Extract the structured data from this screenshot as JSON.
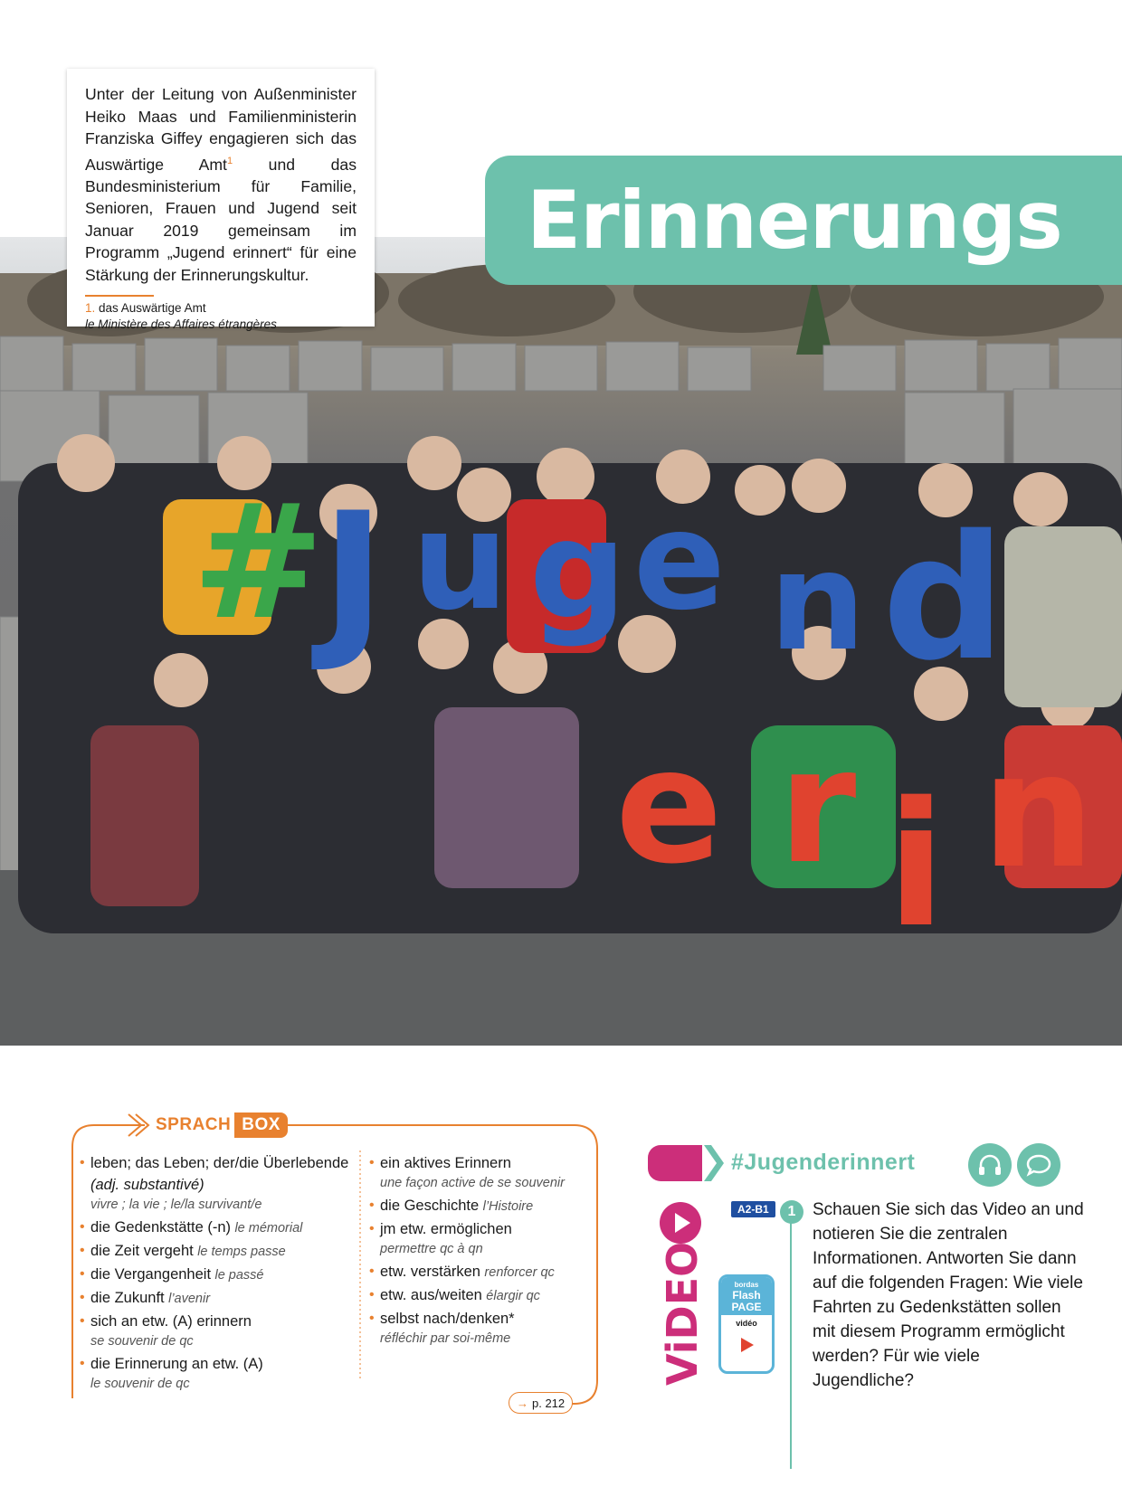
{
  "intro": {
    "text_before_sup": "Unter der Leitung von Außenminister Heiko Maas und Familienministerin Franziska Giffey engagieren sich das Auswärtige Amt",
    "sup": "1",
    "text_after_sup": " und das Bundesministerium für Familie, Senioren, Frauen und Jugend seit Januar 2019 gemeinsam im Programm „Jugend erinnert“ für eine Stärkung der Erinnerungskultur.",
    "footnote_num": "1.",
    "footnote_de": " das Auswärtige Amt",
    "footnote_fr": "le Ministère des Affaires étrangères"
  },
  "title": "Erinnerungs",
  "photo": {
    "letters_top": [
      "#",
      "J",
      "u",
      "g",
      "e",
      "n",
      "d"
    ],
    "letters_bottom": [
      "e",
      "r",
      "i",
      "n"
    ],
    "colors": {
      "hash": "#3aa64a",
      "blue": "#2f5fb8",
      "red": "#e0432f"
    }
  },
  "sprachbox": {
    "label_a": "SPRACH",
    "label_b": "BOX",
    "col1": [
      {
        "de": "leben; das Leben; der/die Überlebende",
        "de_it": " (adj. substantivé)",
        "fr": "vivre ; la vie ; le/la survivant/e",
        "fr_block": true
      },
      {
        "de": "die Gedenkstätte (-n)",
        "fr": "le mémorial"
      },
      {
        "de": "die Zeit vergeht",
        "fr": "le temps passe"
      },
      {
        "de": "die Vergangenheit",
        "fr": "le passé"
      },
      {
        "de": "die Zukunft",
        "fr": "l’avenir"
      },
      {
        "de": "sich an etw. (A) erinnern",
        "fr": "se souvenir de qc",
        "fr_block": true
      },
      {
        "de": "die Erinnerung an etw. (A)",
        "fr": "le souvenir de qc",
        "fr_block": true
      }
    ],
    "col2": [
      {
        "de": "ein aktives Erinnern",
        "fr": "une façon active de se souvenir",
        "fr_block": true
      },
      {
        "de": "die Geschichte",
        "fr": "l’Histoire"
      },
      {
        "de": "jm etw. ermöglichen",
        "fr": "permettre qc à qn",
        "fr_block": true
      },
      {
        "de": "etw. verstärken",
        "fr": "renforcer qc"
      },
      {
        "de": "etw. aus/weiten",
        "fr": "élargir qc"
      },
      {
        "de": "selbst nach/denken*",
        "fr": "réfléchir par soi-même",
        "fr_block": true
      }
    ],
    "page_ref": "p. 212"
  },
  "video": {
    "hashtag": "#Jugenderinnert",
    "word": "ViDEO",
    "level": "A2-B1",
    "flash_brand": "bordas",
    "flash_line1": "Flash",
    "flash_line2": "PAGE",
    "flash_label": "vidéo",
    "q_number": "1",
    "question": "Schauen Sie sich das Video an und notieren Sie die zentralen Informationen. Antworten Sie dann auf die folgenden Fragen: Wie viele Fahrten zu Gedenkstätten sollen mit diesem Programm ermöglicht werden? Für wie viele Jugendliche?",
    "icons": [
      "headphones-icon",
      "speech-bubble-icon"
    ],
    "colors": {
      "accent": "#6dc1ac",
      "video": "#cc2e7a",
      "level": "#1f4fa0"
    }
  }
}
